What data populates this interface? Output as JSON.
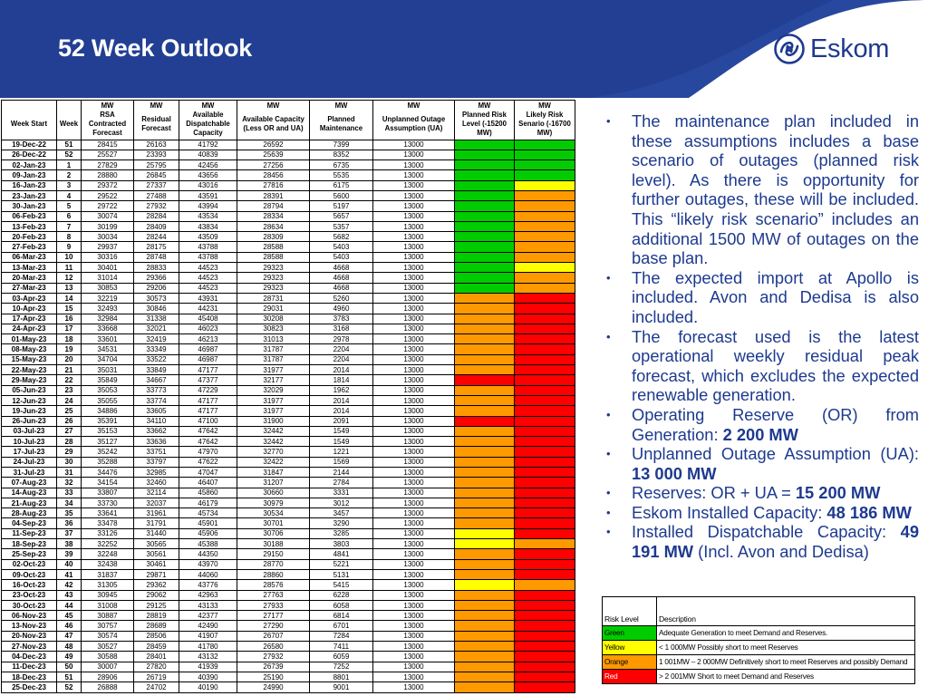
{
  "title": "52 Week Outlook",
  "logo": {
    "text": "Eskom",
    "icon": "eskom-swirl-logo"
  },
  "colors": {
    "green": "#00cc00",
    "yellow": "#ffff00",
    "orange": "#ff9900",
    "red": "#ff0000",
    "header": "#223f93",
    "text_blue": "#1d3a8f"
  },
  "table": {
    "unit_row": [
      "",
      "",
      "MW",
      "MW",
      "MW",
      "MW",
      "MW",
      "MW",
      "MW",
      "MW"
    ],
    "headers": [
      "Week Start",
      "Week",
      "RSA Contracted Forecast",
      "Residual Forecast",
      "Available Dispatchable Capacity",
      "Available Capacity (Less OR and UA)",
      "Planned Maintenance",
      "Unplanned Outage Assumption (UA)",
      "Planned Risk Level (-15200 MW)",
      "Likely Risk Senario (-16700 MW)"
    ],
    "rows": [
      {
        "date": "19-Dec-22",
        "week": "51",
        "rsa": "28415",
        "res": "26163",
        "adc": "41792",
        "acl": "26592",
        "pm": "7399",
        "ua": "13000",
        "planned": "green",
        "likely": "green"
      },
      {
        "date": "26-Dec-22",
        "week": "52",
        "rsa": "25527",
        "res": "23393",
        "adc": "40839",
        "acl": "25639",
        "pm": "8352",
        "ua": "13000",
        "planned": "green",
        "likely": "green"
      },
      {
        "date": "02-Jan-23",
        "week": "1",
        "rsa": "27829",
        "res": "25795",
        "adc": "42456",
        "acl": "27256",
        "pm": "6735",
        "ua": "13000",
        "planned": "green",
        "likely": "green"
      },
      {
        "date": "09-Jan-23",
        "week": "2",
        "rsa": "28880",
        "res": "26845",
        "adc": "43656",
        "acl": "28456",
        "pm": "5535",
        "ua": "13000",
        "planned": "green",
        "likely": "green"
      },
      {
        "date": "16-Jan-23",
        "week": "3",
        "rsa": "29372",
        "res": "27337",
        "adc": "43016",
        "acl": "27816",
        "pm": "6175",
        "ua": "13000",
        "planned": "green",
        "likely": "yellow"
      },
      {
        "date": "23-Jan-23",
        "week": "4",
        "rsa": "29522",
        "res": "27488",
        "adc": "43591",
        "acl": "28391",
        "pm": "5600",
        "ua": "13000",
        "planned": "green",
        "likely": "orange"
      },
      {
        "date": "30-Jan-23",
        "week": "5",
        "rsa": "29722",
        "res": "27932",
        "adc": "43994",
        "acl": "28794",
        "pm": "5197",
        "ua": "13000",
        "planned": "green",
        "likely": "orange"
      },
      {
        "date": "06-Feb-23",
        "week": "6",
        "rsa": "30074",
        "res": "28284",
        "adc": "43534",
        "acl": "28334",
        "pm": "5657",
        "ua": "13000",
        "planned": "green",
        "likely": "orange"
      },
      {
        "date": "13-Feb-23",
        "week": "7",
        "rsa": "30199",
        "res": "28409",
        "adc": "43834",
        "acl": "28634",
        "pm": "5357",
        "ua": "13000",
        "planned": "green",
        "likely": "orange"
      },
      {
        "date": "20-Feb-23",
        "week": "8",
        "rsa": "30034",
        "res": "28244",
        "adc": "43509",
        "acl": "28309",
        "pm": "5682",
        "ua": "13000",
        "planned": "green",
        "likely": "orange"
      },
      {
        "date": "27-Feb-23",
        "week": "9",
        "rsa": "29937",
        "res": "28175",
        "adc": "43788",
        "acl": "28588",
        "pm": "5403",
        "ua": "13000",
        "planned": "green",
        "likely": "orange"
      },
      {
        "date": "06-Mar-23",
        "week": "10",
        "rsa": "30316",
        "res": "28748",
        "adc": "43788",
        "acl": "28588",
        "pm": "5403",
        "ua": "13000",
        "planned": "green",
        "likely": "orange"
      },
      {
        "date": "13-Mar-23",
        "week": "11",
        "rsa": "30401",
        "res": "28833",
        "adc": "44523",
        "acl": "29323",
        "pm": "4668",
        "ua": "13000",
        "planned": "green",
        "likely": "yellow"
      },
      {
        "date": "20-Mar-23",
        "week": "12",
        "rsa": "31014",
        "res": "29366",
        "adc": "44523",
        "acl": "29323",
        "pm": "4668",
        "ua": "13000",
        "planned": "green",
        "likely": "orange"
      },
      {
        "date": "27-Mar-23",
        "week": "13",
        "rsa": "30853",
        "res": "29206",
        "adc": "44523",
        "acl": "29323",
        "pm": "4668",
        "ua": "13000",
        "planned": "green",
        "likely": "orange"
      },
      {
        "date": "03-Apr-23",
        "week": "14",
        "rsa": "32219",
        "res": "30573",
        "adc": "43931",
        "acl": "28731",
        "pm": "5260",
        "ua": "13000",
        "planned": "orange",
        "likely": "red"
      },
      {
        "date": "10-Apr-23",
        "week": "15",
        "rsa": "32493",
        "res": "30846",
        "adc": "44231",
        "acl": "29031",
        "pm": "4960",
        "ua": "13000",
        "planned": "orange",
        "likely": "red"
      },
      {
        "date": "17-Apr-23",
        "week": "16",
        "rsa": "32984",
        "res": "31338",
        "adc": "45408",
        "acl": "30208",
        "pm": "3783",
        "ua": "13000",
        "planned": "orange",
        "likely": "red"
      },
      {
        "date": "24-Apr-23",
        "week": "17",
        "rsa": "33668",
        "res": "32021",
        "adc": "46023",
        "acl": "30823",
        "pm": "3168",
        "ua": "13000",
        "planned": "orange",
        "likely": "red"
      },
      {
        "date": "01-May-23",
        "week": "18",
        "rsa": "33601",
        "res": "32419",
        "adc": "46213",
        "acl": "31013",
        "pm": "2978",
        "ua": "13000",
        "planned": "orange",
        "likely": "red"
      },
      {
        "date": "08-May-23",
        "week": "19",
        "rsa": "34531",
        "res": "33349",
        "adc": "46987",
        "acl": "31787",
        "pm": "2204",
        "ua": "13000",
        "planned": "orange",
        "likely": "red"
      },
      {
        "date": "15-May-23",
        "week": "20",
        "rsa": "34704",
        "res": "33522",
        "adc": "46987",
        "acl": "31787",
        "pm": "2204",
        "ua": "13000",
        "planned": "orange",
        "likely": "red"
      },
      {
        "date": "22-May-23",
        "week": "21",
        "rsa": "35031",
        "res": "33849",
        "adc": "47177",
        "acl": "31977",
        "pm": "2014",
        "ua": "13000",
        "planned": "orange",
        "likely": "red"
      },
      {
        "date": "29-May-23",
        "week": "22",
        "rsa": "35849",
        "res": "34667",
        "adc": "47377",
        "acl": "32177",
        "pm": "1814",
        "ua": "13000",
        "planned": "red",
        "likely": "red"
      },
      {
        "date": "05-Jun-23",
        "week": "23",
        "rsa": "35053",
        "res": "33773",
        "adc": "47229",
        "acl": "32029",
        "pm": "1962",
        "ua": "13000",
        "planned": "orange",
        "likely": "red"
      },
      {
        "date": "12-Jun-23",
        "week": "24",
        "rsa": "35055",
        "res": "33774",
        "adc": "47177",
        "acl": "31977",
        "pm": "2014",
        "ua": "13000",
        "planned": "orange",
        "likely": "red"
      },
      {
        "date": "19-Jun-23",
        "week": "25",
        "rsa": "34886",
        "res": "33605",
        "adc": "47177",
        "acl": "31977",
        "pm": "2014",
        "ua": "13000",
        "planned": "orange",
        "likely": "red"
      },
      {
        "date": "26-Jun-23",
        "week": "26",
        "rsa": "35391",
        "res": "34110",
        "adc": "47100",
        "acl": "31900",
        "pm": "2091",
        "ua": "13000",
        "planned": "red",
        "likely": "red"
      },
      {
        "date": "03-Jul-23",
        "week": "27",
        "rsa": "35153",
        "res": "33662",
        "adc": "47642",
        "acl": "32442",
        "pm": "1549",
        "ua": "13000",
        "planned": "orange",
        "likely": "red"
      },
      {
        "date": "10-Jul-23",
        "week": "28",
        "rsa": "35127",
        "res": "33636",
        "adc": "47642",
        "acl": "32442",
        "pm": "1549",
        "ua": "13000",
        "planned": "orange",
        "likely": "red"
      },
      {
        "date": "17-Jul-23",
        "week": "29",
        "rsa": "35242",
        "res": "33751",
        "adc": "47970",
        "acl": "32770",
        "pm": "1221",
        "ua": "13000",
        "planned": "orange",
        "likely": "red"
      },
      {
        "date": "24-Jul-23",
        "week": "30",
        "rsa": "35288",
        "res": "33797",
        "adc": "47622",
        "acl": "32422",
        "pm": "1569",
        "ua": "13000",
        "planned": "orange",
        "likely": "red"
      },
      {
        "date": "31-Jul-23",
        "week": "31",
        "rsa": "34476",
        "res": "32985",
        "adc": "47047",
        "acl": "31847",
        "pm": "2144",
        "ua": "13000",
        "planned": "orange",
        "likely": "red"
      },
      {
        "date": "07-Aug-23",
        "week": "32",
        "rsa": "34154",
        "res": "32460",
        "adc": "46407",
        "acl": "31207",
        "pm": "2784",
        "ua": "13000",
        "planned": "orange",
        "likely": "red"
      },
      {
        "date": "14-Aug-23",
        "week": "33",
        "rsa": "33807",
        "res": "32114",
        "adc": "45860",
        "acl": "30660",
        "pm": "3331",
        "ua": "13000",
        "planned": "orange",
        "likely": "red"
      },
      {
        "date": "21-Aug-23",
        "week": "34",
        "rsa": "33730",
        "res": "32037",
        "adc": "46179",
        "acl": "30979",
        "pm": "3012",
        "ua": "13000",
        "planned": "orange",
        "likely": "red"
      },
      {
        "date": "28-Aug-23",
        "week": "35",
        "rsa": "33641",
        "res": "31961",
        "adc": "45734",
        "acl": "30534",
        "pm": "3457",
        "ua": "13000",
        "planned": "orange",
        "likely": "red"
      },
      {
        "date": "04-Sep-23",
        "week": "36",
        "rsa": "33478",
        "res": "31791",
        "adc": "45901",
        "acl": "30701",
        "pm": "3290",
        "ua": "13000",
        "planned": "orange",
        "likely": "red"
      },
      {
        "date": "11-Sep-23",
        "week": "37",
        "rsa": "33126",
        "res": "31440",
        "adc": "45906",
        "acl": "30706",
        "pm": "3285",
        "ua": "13000",
        "planned": "yellow",
        "likely": "red"
      },
      {
        "date": "18-Sep-23",
        "week": "38",
        "rsa": "32252",
        "res": "30565",
        "adc": "45388",
        "acl": "30188",
        "pm": "3803",
        "ua": "13000",
        "planned": "yellow",
        "likely": "orange"
      },
      {
        "date": "25-Sep-23",
        "week": "39",
        "rsa": "32248",
        "res": "30561",
        "adc": "44350",
        "acl": "29150",
        "pm": "4841",
        "ua": "13000",
        "planned": "orange",
        "likely": "red"
      },
      {
        "date": "02-Oct-23",
        "week": "40",
        "rsa": "32438",
        "res": "30461",
        "adc": "43970",
        "acl": "28770",
        "pm": "5221",
        "ua": "13000",
        "planned": "orange",
        "likely": "red"
      },
      {
        "date": "09-Oct-23",
        "week": "41",
        "rsa": "31837",
        "res": "29871",
        "adc": "44060",
        "acl": "28860",
        "pm": "5131",
        "ua": "13000",
        "planned": "orange",
        "likely": "red"
      },
      {
        "date": "16-Oct-23",
        "week": "42",
        "rsa": "31305",
        "res": "29362",
        "adc": "43776",
        "acl": "28576",
        "pm": "5415",
        "ua": "13000",
        "planned": "yellow",
        "likely": "orange"
      },
      {
        "date": "23-Oct-23",
        "week": "43",
        "rsa": "30945",
        "res": "29062",
        "adc": "42963",
        "acl": "27763",
        "pm": "6228",
        "ua": "13000",
        "planned": "orange",
        "likely": "red"
      },
      {
        "date": "30-Oct-23",
        "week": "44",
        "rsa": "31008",
        "res": "29125",
        "adc": "43133",
        "acl": "27933",
        "pm": "6058",
        "ua": "13000",
        "planned": "orange",
        "likely": "red"
      },
      {
        "date": "06-Nov-23",
        "week": "45",
        "rsa": "30887",
        "res": "28819",
        "adc": "42377",
        "acl": "27177",
        "pm": "6814",
        "ua": "13000",
        "planned": "orange",
        "likely": "red"
      },
      {
        "date": "13-Nov-23",
        "week": "46",
        "rsa": "30757",
        "res": "28689",
        "adc": "42490",
        "acl": "27290",
        "pm": "6701",
        "ua": "13000",
        "planned": "orange",
        "likely": "red"
      },
      {
        "date": "20-Nov-23",
        "week": "47",
        "rsa": "30574",
        "res": "28506",
        "adc": "41907",
        "acl": "26707",
        "pm": "7284",
        "ua": "13000",
        "planned": "orange",
        "likely": "red"
      },
      {
        "date": "27-Nov-23",
        "week": "48",
        "rsa": "30527",
        "res": "28459",
        "adc": "41780",
        "acl": "26580",
        "pm": "7411",
        "ua": "13000",
        "planned": "orange",
        "likely": "red"
      },
      {
        "date": "04-Dec-23",
        "week": "49",
        "rsa": "30588",
        "res": "28401",
        "adc": "43132",
        "acl": "27932",
        "pm": "6059",
        "ua": "13000",
        "planned": "orange",
        "likely": "red"
      },
      {
        "date": "11-Dec-23",
        "week": "50",
        "rsa": "30007",
        "res": "27820",
        "adc": "41939",
        "acl": "26739",
        "pm": "7252",
        "ua": "13000",
        "planned": "orange",
        "likely": "red"
      },
      {
        "date": "18-Dec-23",
        "week": "51",
        "rsa": "28906",
        "res": "26719",
        "adc": "40390",
        "acl": "25190",
        "pm": "8801",
        "ua": "13000",
        "planned": "orange",
        "likely": "red"
      },
      {
        "date": "25-Dec-23",
        "week": "52",
        "rsa": "26888",
        "res": "24702",
        "adc": "40190",
        "acl": "24990",
        "pm": "9001",
        "ua": "13000",
        "planned": "orange",
        "likely": "red"
      }
    ]
  },
  "bullets": [
    {
      "pre": "The maintenance plan included in these assumptions includes a base scenario of outages (planned risk level). As there is opportunity for further outages, these will be included. This “likely risk scenario” includes an additional 1500 MW of outages on the base plan.",
      "bold": "",
      "post": ""
    },
    {
      "pre": "The expected import at Apollo is included. Avon and Dedisa is also included.",
      "bold": "",
      "post": ""
    },
    {
      "pre": "The forecast used is the latest operational weekly residual peak forecast, which excludes the expected renewable generation.",
      "bold": "",
      "post": ""
    },
    {
      "pre": "Operating Reserve (OR) from Generation:  ",
      "bold": "2 200 MW",
      "post": ""
    },
    {
      "pre": "Unplanned Outage Assumption (UA): ",
      "bold": "13 000 MW",
      "post": ""
    },
    {
      "pre": "Reserves: OR + UA = ",
      "bold": "15 200 MW",
      "post": ""
    },
    {
      "pre": "Eskom Installed Capacity: ",
      "bold": "48 186 MW",
      "post": ""
    },
    {
      "pre": "Installed Dispatchable Capacity: ",
      "bold": "49 191 MW",
      "post": " (Incl. Avon and Dedisa)"
    }
  ],
  "legend": {
    "headers": [
      "Risk Level",
      "Description"
    ],
    "rows": [
      {
        "level": "Green",
        "color": "green",
        "desc": "Adequate Generation to meet Demand and Reserves."
      },
      {
        "level": "Yellow",
        "color": "yellow",
        "desc": "< 1 000MW Possibly short to meet Reserves"
      },
      {
        "level": "Orange",
        "color": "orange",
        "desc": "1 001MW – 2 000MW Definitively short to meet Reserves and possibly Demand"
      },
      {
        "level": "Red",
        "color": "red",
        "desc": "> 2 001MW Short to meet Demand and Reserves"
      }
    ]
  }
}
